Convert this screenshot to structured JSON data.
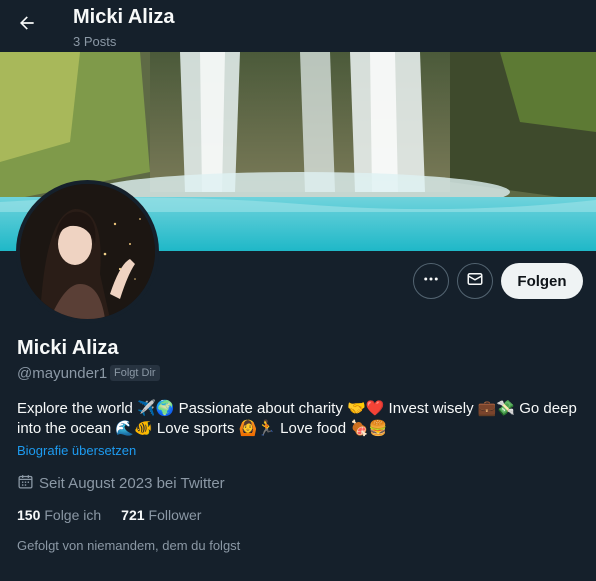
{
  "header": {
    "title": "Micki Aliza",
    "posts_count": "3 Posts"
  },
  "actions": {
    "follow_label": "Folgen"
  },
  "profile": {
    "name": "Micki Aliza",
    "handle": "@mayunder1",
    "follows_you_badge": "Folgt Dir",
    "bio": "Explore the world ✈️🌍 Passionate about charity 🤝❤️ Invest wisely 💼💸 Go deep into the ocean 🌊🐠 Love sports 🙆🏃 Love food 🍖🍔",
    "translate_link": "Biografie übersetzen",
    "joined": "Seit August 2023 bei Twitter",
    "following_count": "150",
    "following_label": "Folge ich",
    "followers_count": "721",
    "followers_label": "Follower",
    "followed_by": "Gefolgt von niemandem, dem du folgst"
  },
  "colors": {
    "background": "#15202b",
    "accent": "#1d9bf0",
    "muted_text": "#8b98a5",
    "follow_button": "#eff3f4"
  }
}
